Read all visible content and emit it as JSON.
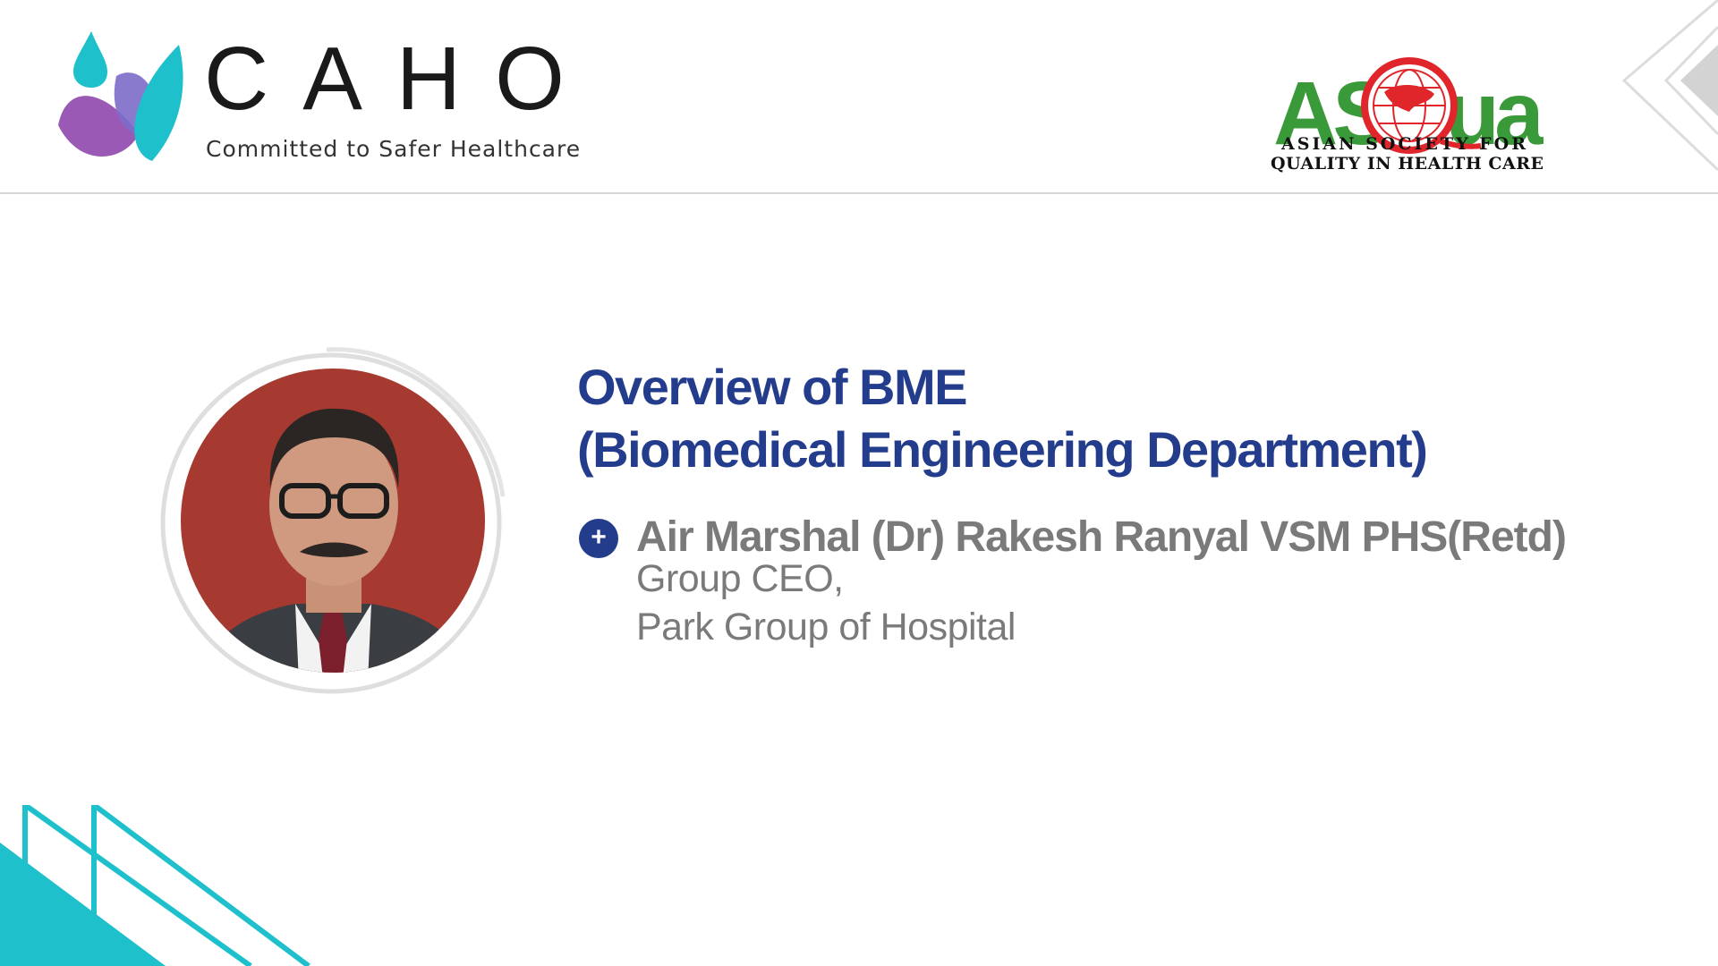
{
  "header": {
    "caho_name": "CAHO",
    "caho_tagline": "Committed to Safer Healthcare",
    "asqua_wordmark": "ASQua",
    "asqua_line1": "ASIAN SOCIETY FOR",
    "asqua_line2": "QUALITY IN HEALTH CARE"
  },
  "slide": {
    "title_line1": "Overview of BME",
    "title_line2": "(Biomedical Engineering Department)",
    "speaker_name": "Air Marshal (Dr) Rakesh Ranyal VSM PHS(Retd)",
    "speaker_role_line1": "Group CEO,",
    "speaker_role_line2": "Park Group of Hospital"
  },
  "icons": {
    "bullet": "plus-circle-icon",
    "caho_logo": "droplet-leaf-logo",
    "asqua_globe": "globe-icon"
  },
  "colors": {
    "title_blue": "#233d8c",
    "text_gray": "#7a7a7a",
    "teal": "#1ec0cc",
    "purple": "#9b59b6",
    "asqua_green": "#3a9a3a",
    "asqua_red": "#e0262b",
    "photo_bg": "#a63a30"
  }
}
